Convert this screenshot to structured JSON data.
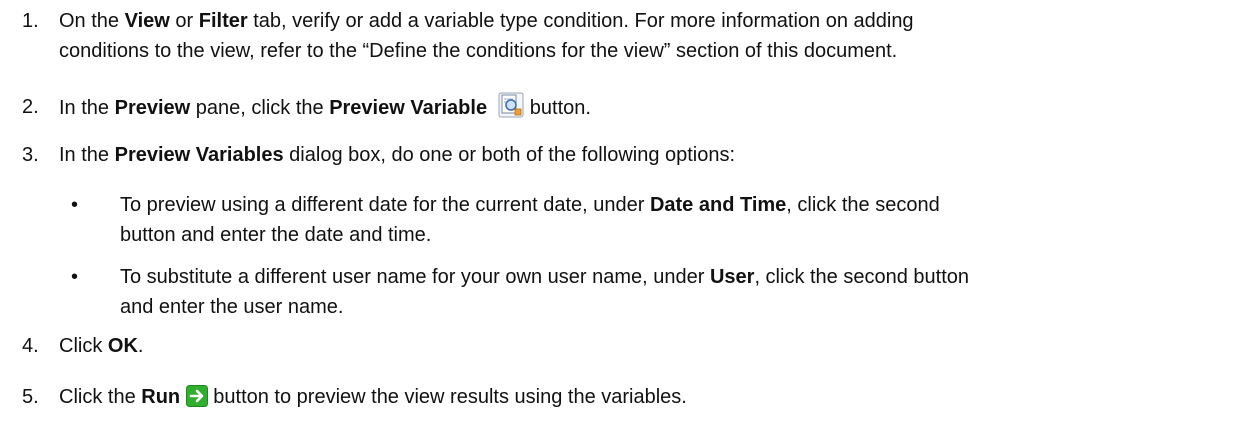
{
  "steps": [
    {
      "num": "1.",
      "t1": "On the ",
      "b1": "View",
      "t2": " or ",
      "b2": "Filter",
      "t3": " tab, verify or add a variable type condition. For more information on adding",
      "line2": "conditions to the view, refer to the “Define the conditions for the view” section of this document."
    },
    {
      "num": "2.",
      "t1": "In the ",
      "b1": "Preview",
      "t2": " pane, click the ",
      "b2": "Preview Variable",
      "icon": "preview-variable-icon",
      "t3": " button."
    },
    {
      "num": "3.",
      "t1": "In the ",
      "b1": "Preview Variables",
      "t2": " dialog box, do one or both of the following options:"
    },
    {
      "num": "4.",
      "t1": "Click ",
      "b1": "OK",
      "t2": "."
    },
    {
      "num": "5.",
      "t1": "Click the ",
      "b1": "Run",
      "icon": "run-arrow-icon",
      "t2": " button to preview the view results using the variables."
    }
  ],
  "bullets": [
    {
      "dot": "•",
      "t1": "To preview using a different date for the current date, under ",
      "b1": "Date and Time",
      "t2": ", click the second",
      "line2": "button and enter the date and time."
    },
    {
      "dot": "•",
      "t1": "To substitute a different user name for your own user name, under ",
      "b1": "User",
      "t2": ", click the second button",
      "line2": "and enter the user name."
    }
  ],
  "colors": {
    "text": "#111111",
    "run_icon_green": "#2fae2f"
  }
}
